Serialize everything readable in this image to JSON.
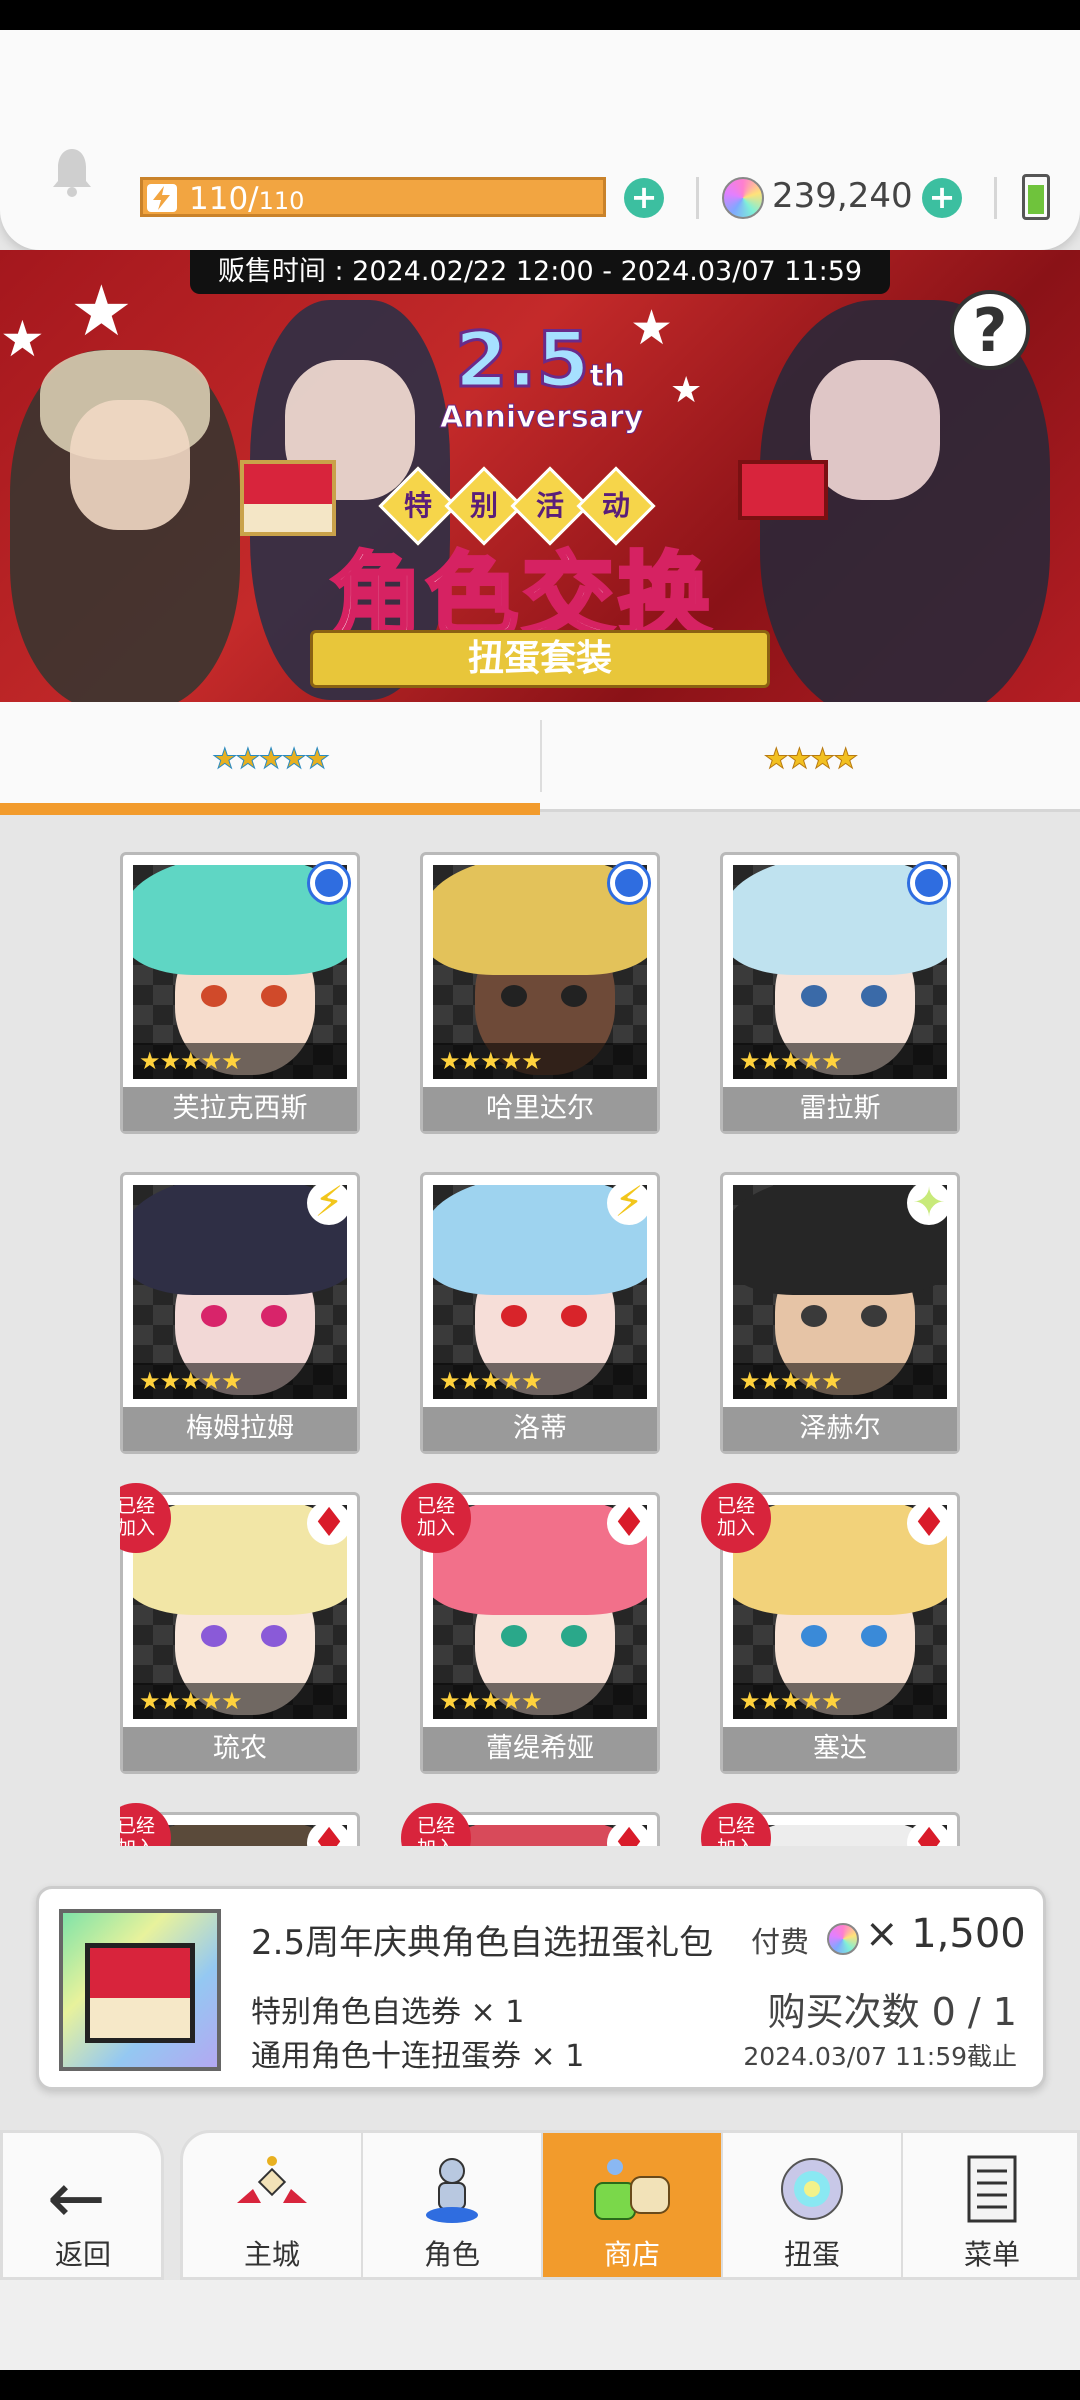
{
  "header": {
    "energy_current": "110/",
    "energy_max": "110",
    "gem_count": "239,240",
    "plus_symbol": "+"
  },
  "banner": {
    "sale_time": "贩售时间 : 2024.02/22 12:00 - 2024.03/07 11:59",
    "anniversary_number": "2.5",
    "anniversary_suffix": "th",
    "anniversary_word": "Anniversary",
    "event_tags": [
      "特",
      "别",
      "活",
      "动"
    ],
    "event_title": "角色交换",
    "ribbon": "扭蛋套装",
    "help_symbol": "?"
  },
  "tabs": [
    {
      "label": "★★★★★",
      "active": true
    },
    {
      "label": "★★★★",
      "active": false
    }
  ],
  "characters": [
    {
      "name": "芙拉克西斯",
      "element": "water",
      "joined": false,
      "hair": "#5fd6c4",
      "skin": "#f6dccb",
      "eye": "#d04a2a"
    },
    {
      "name": "哈里达尔",
      "element": "water",
      "joined": false,
      "hair": "#e3c25a",
      "skin": "#6e4a38",
      "eye": "#222222"
    },
    {
      "name": "雷拉斯",
      "element": "water",
      "joined": false,
      "hair": "#bfe2ef",
      "skin": "#f6e2d8",
      "eye": "#3a6aa8"
    },
    {
      "name": "梅姆拉姆",
      "element": "bolt",
      "joined": false,
      "hair": "#2f2f45",
      "skin": "#f2d8d6",
      "eye": "#d8246a"
    },
    {
      "name": "洛蒂",
      "element": "bolt",
      "joined": false,
      "hair": "#9ed3ef",
      "skin": "#f6ded8",
      "eye": "#d8242a"
    },
    {
      "name": "泽赫尔",
      "element": "spark",
      "joined": false,
      "hair": "#262626",
      "skin": "#e6c4a6",
      "eye": "#3a3a3a"
    },
    {
      "name": "琉农",
      "element": "ruby",
      "joined": true,
      "hair": "#f2e6a6",
      "skin": "#f8e6da",
      "eye": "#8a5ad8"
    },
    {
      "name": "蕾缇希娅",
      "element": "ruby",
      "joined": true,
      "hair": "#f2708a",
      "skin": "#f8e2d8",
      "eye": "#2aa88a"
    },
    {
      "name": "塞达",
      "element": "ruby",
      "joined": true,
      "hair": "#f2d27a",
      "skin": "#f8e2d4",
      "eye": "#3a8ad8"
    },
    {
      "name": "",
      "element": "ruby",
      "joined": true,
      "hair": "#5a4a3a",
      "skin": "#e6c8b4",
      "eye": "#333333"
    },
    {
      "name": "",
      "element": "ruby",
      "joined": true,
      "hair": "#d84a5a",
      "skin": "#f4dcd2",
      "eye": "#333333"
    },
    {
      "name": "",
      "element": "ruby",
      "joined": true,
      "hair": "#ededed",
      "skin": "#f4dcd2",
      "eye": "#333333"
    }
  ],
  "card_stars": "★★★★★",
  "joined_label_1": "已经",
  "joined_label_2": "加入",
  "element_symbols": {
    "bolt": "⚡",
    "spark": "✦",
    "ruby": "♦"
  },
  "product": {
    "name": "2.5周年庆典角色自选扭蛋礼包",
    "paid_label": "付费",
    "price": "× 1,500",
    "item_1": "特别角色自选券 × 1",
    "item_2": "通用角色十连扭蛋券 × 1",
    "buy_count": "购买次数 0 / 1",
    "deadline": "2024.03/07 11:59截止"
  },
  "nav": {
    "back": "返回",
    "back_arrow": "←",
    "items": [
      {
        "label": "主城",
        "icon": "castle-icon",
        "active": false
      },
      {
        "label": "角色",
        "icon": "character-icon",
        "active": false
      },
      {
        "label": "商店",
        "icon": "shop-icon",
        "active": true
      },
      {
        "label": "扭蛋",
        "icon": "gacha-icon",
        "active": false
      },
      {
        "label": "菜单",
        "icon": "menu-icon",
        "active": false
      }
    ]
  },
  "colors": {
    "accent": "#f29b2c",
    "energy": "#f2a541",
    "plus": "#3cbfa0",
    "banner_red": "#b51e24"
  }
}
